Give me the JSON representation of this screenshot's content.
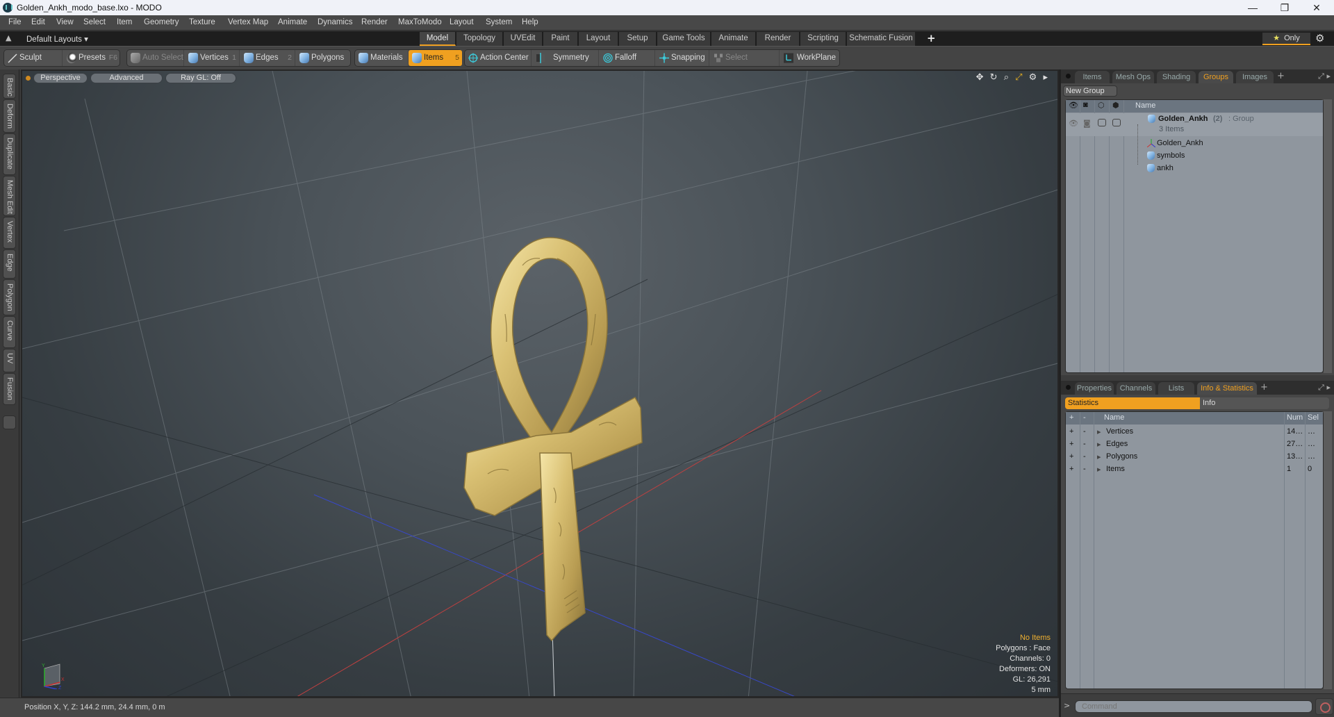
{
  "window": {
    "title": "Golden_Ankh_modo_base.lxo - MODO",
    "minimize": "—",
    "maximize": "❐",
    "close": "✕"
  },
  "menu": [
    "File",
    "Edit",
    "View",
    "Select",
    "Item",
    "Geometry",
    "Texture",
    "Vertex Map",
    "Animate",
    "Dynamics",
    "Render",
    "MaxToModo",
    "Layout",
    "System",
    "Help"
  ],
  "layouts": {
    "dropdown": "Default Layouts ▾",
    "tabs": [
      "Model",
      "Topology",
      "UVEdit",
      "Paint",
      "Layout",
      "Setup",
      "Game Tools",
      "Animate",
      "Render",
      "Scripting",
      "Schematic Fusion"
    ],
    "active_tab": "Model",
    "add": "+",
    "only_label": "Only",
    "only_star": "★"
  },
  "toolbar": {
    "sculpt": "Sculpt",
    "presets": "Presets",
    "presets_key": "F6",
    "auto_select": "Auto Select",
    "vertices": "Vertices",
    "vertices_key": "1",
    "edges": "Edges",
    "edges_key": "2",
    "polygons": "Polygons",
    "materials": "Materials",
    "items": "Items",
    "items_key": "5",
    "action_center": "Action Center",
    "symmetry": "Symmetry",
    "falloff": "Falloff",
    "snapping": "Snapping",
    "select_through": "Select Through",
    "workplane": "WorkPlane",
    "active_mode": "Items",
    "accent_color": "#f0a020"
  },
  "left_tabs": [
    "Basic",
    "Deform",
    "Duplicate",
    "Mesh Edit",
    "Vertex",
    "Edge",
    "Polygon",
    "Curve",
    "UV",
    "Fusion"
  ],
  "viewport": {
    "view": "Perspective",
    "shading": "Advanced",
    "raygl": "Ray GL: Off",
    "info": {
      "selection": "No Items",
      "polygons": "Polygons : Face",
      "channels": "Channels: 0",
      "deformers": "Deformers: ON",
      "gl": "GL: 26,291",
      "grid": "5 mm"
    },
    "axis_labels": {
      "x": "X",
      "y": "Y",
      "z": "Z"
    }
  },
  "status": {
    "position": "Position X, Y, Z:   144.2 mm, 24.4 mm, 0 m"
  },
  "groups_panel": {
    "tabs": [
      "Items",
      "Mesh Ops",
      "Shading",
      "Groups",
      "Images"
    ],
    "active_tab": "Groups",
    "new_group": "New Group",
    "name_header": "Name",
    "group": {
      "name": "Golden_Ankh",
      "count": "(2)",
      "type": ": Group",
      "sub": "3 Items"
    },
    "children": [
      {
        "name": "Golden_Ankh",
        "icon": "locator-icon"
      },
      {
        "name": "symbols",
        "icon": "mesh-icon"
      },
      {
        "name": "ankh",
        "icon": "mesh-icon"
      }
    ]
  },
  "stats_panel": {
    "tabs": [
      "Properties",
      "Channels",
      "Lists",
      "Info & Statistics"
    ],
    "active_tab": "Info & Statistics",
    "subtabs": [
      "Statistics",
      "Info"
    ],
    "active_subtab": "Statistics",
    "headers": {
      "plus": "+",
      "minus": "-",
      "name": "Name",
      "num": "Num",
      "sel": "Sel"
    },
    "rows": [
      {
        "name": "Vertices",
        "num": "14…",
        "sel": "…"
      },
      {
        "name": "Edges",
        "num": "27…",
        "sel": "…"
      },
      {
        "name": "Polygons",
        "num": "13…",
        "sel": "…"
      },
      {
        "name": "Items",
        "num": "1",
        "sel": "0"
      }
    ]
  },
  "command": {
    "prompt": ">",
    "placeholder": "Command"
  }
}
